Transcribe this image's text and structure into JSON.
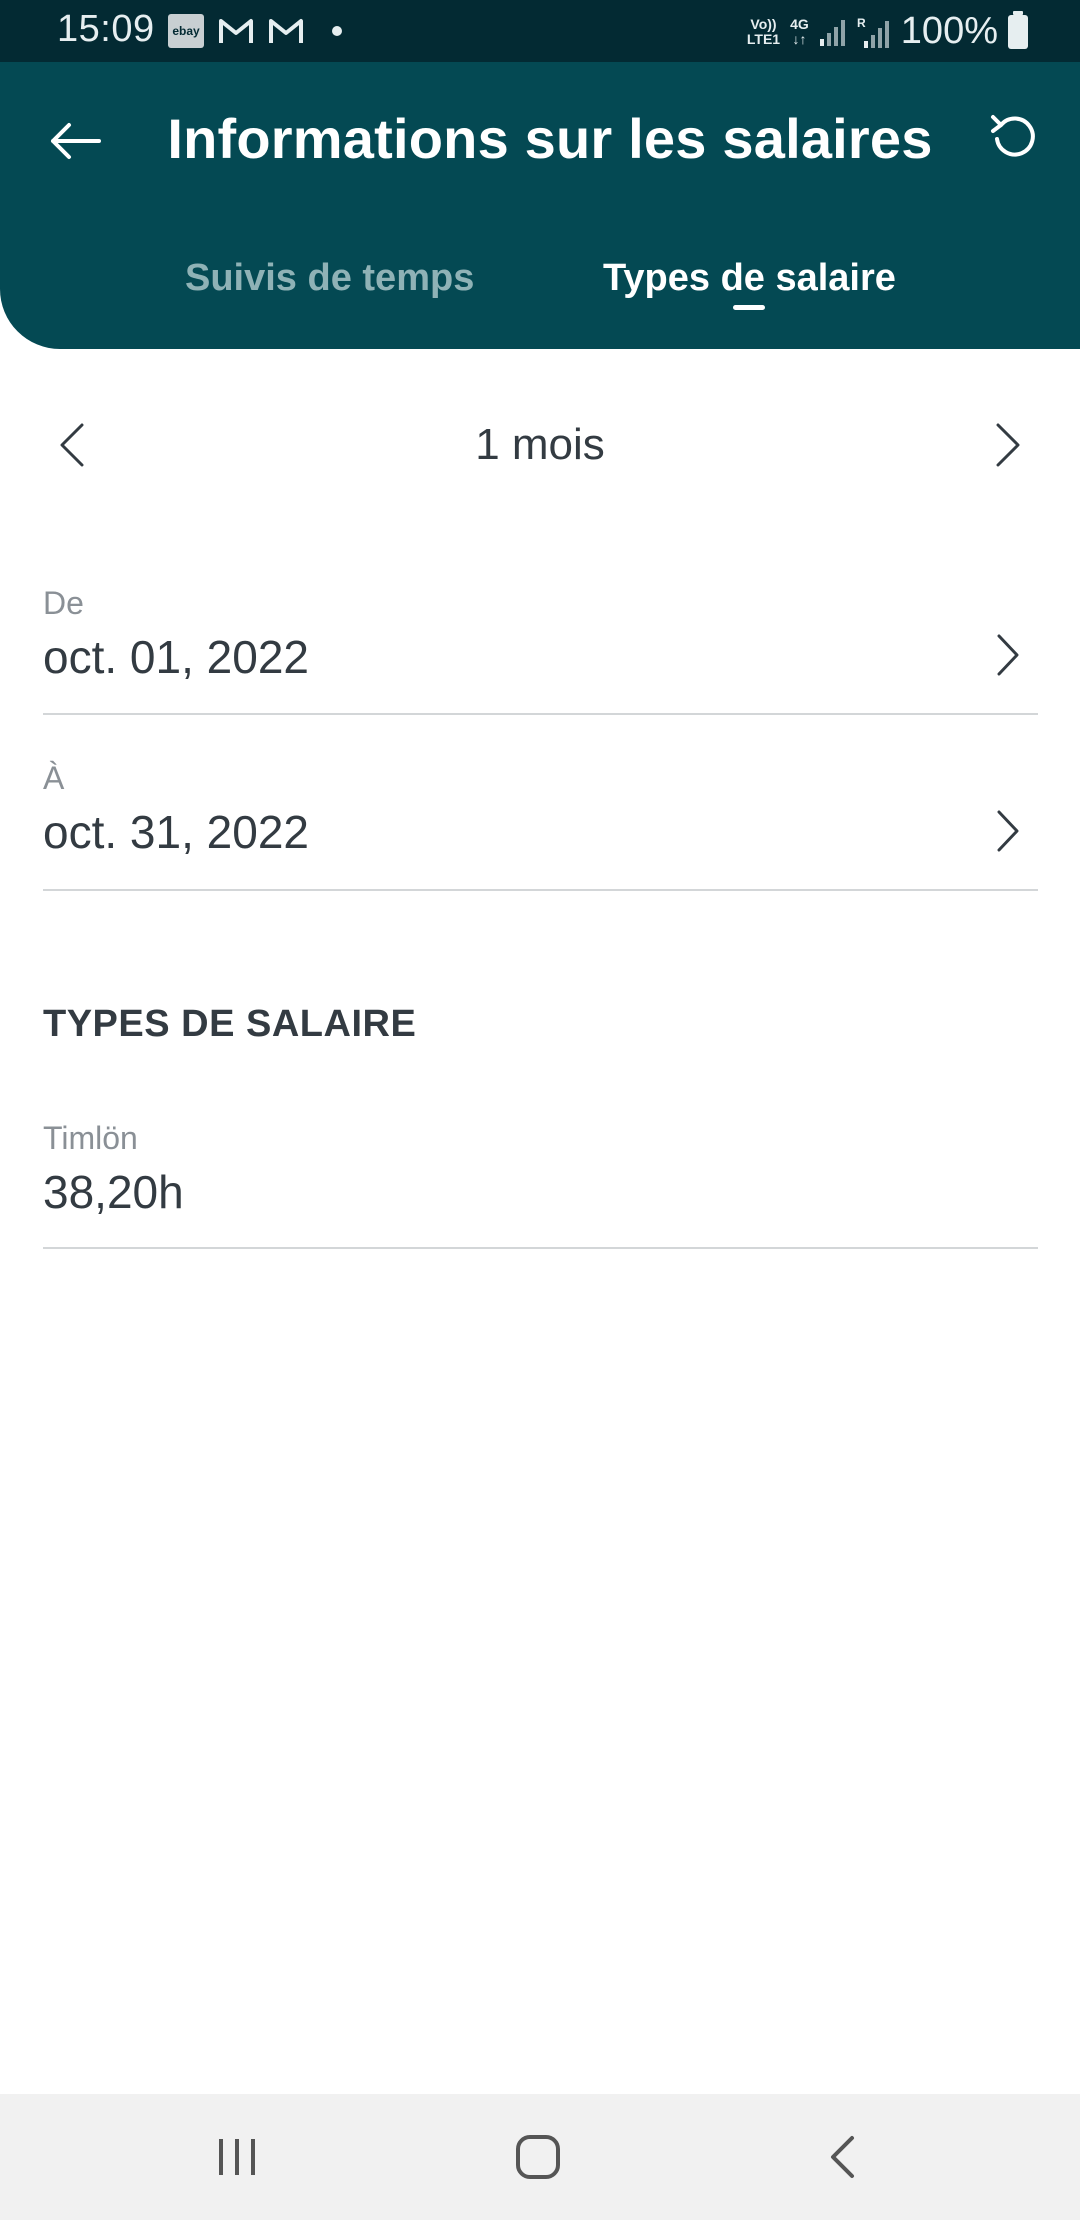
{
  "status_bar": {
    "time": "15:09",
    "ebay_badge": "ebay",
    "volte": "Vo))\nLTE1",
    "network": "4G",
    "roaming": "R",
    "battery": "100%"
  },
  "app_bar": {
    "title": "Informations sur les salaires",
    "back_icon": "arrow-left-icon",
    "refresh_icon": "refresh-icon",
    "tabs": [
      {
        "label": "Suivis de temps",
        "active": false
      },
      {
        "label": "Types de salaire",
        "active": true
      }
    ]
  },
  "period": {
    "label": "1 mois"
  },
  "date_range": {
    "from": {
      "label": "De",
      "value": "oct. 01, 2022"
    },
    "to": {
      "label": "À",
      "value": "oct. 31, 2022"
    }
  },
  "wage_types": {
    "section_title": "TYPES DE SALAIRE",
    "items": [
      {
        "name": "Timlön",
        "value": "38,20h"
      }
    ]
  },
  "colors": {
    "appbar": "#044953",
    "statusbar": "#032a33",
    "tab_inactive": "#8fb2b6",
    "text": "#333b42",
    "divider": "#d3d6d8"
  }
}
